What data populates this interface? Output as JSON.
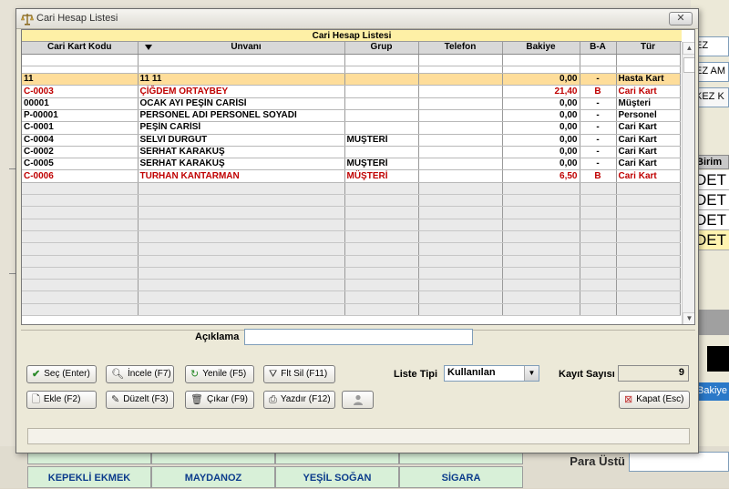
{
  "window": {
    "title": "Cari Hesap Listesi",
    "close_label": "✕"
  },
  "grid": {
    "caption": "Cari Hesap Listesi",
    "columns": [
      "Cari Kart Kodu",
      "Ünvanı",
      "Grup",
      "Telefon",
      "Bakiye",
      "B-A",
      "Tür"
    ],
    "rows": [
      {
        "kod": "11",
        "unvan": "11 11",
        "grup": "",
        "telefon": "",
        "bakiye": "0,00",
        "ba": "-",
        "tur": "Hasta Kart",
        "selected": true,
        "red": false
      },
      {
        "kod": "C-0003",
        "unvan": "ÇİĞDEM ORTAYBEY",
        "grup": "",
        "telefon": "",
        "bakiye": "21,40",
        "ba": "B",
        "tur": "Cari Kart",
        "selected": false,
        "red": true
      },
      {
        "kod": "00001",
        "unvan": "OCAK AYI PEŞİN CARİSİ",
        "grup": "",
        "telefon": "",
        "bakiye": "0,00",
        "ba": "-",
        "tur": "Müşteri",
        "selected": false,
        "red": false
      },
      {
        "kod": "P-00001",
        "unvan": "PERSONEL ADI PERSONEL SOYADI",
        "grup": "",
        "telefon": "",
        "bakiye": "0,00",
        "ba": "-",
        "tur": "Personel",
        "selected": false,
        "red": false
      },
      {
        "kod": "C-0001",
        "unvan": "PEŞİN CARİSİ",
        "grup": "",
        "telefon": "",
        "bakiye": "0,00",
        "ba": "-",
        "tur": "Cari Kart",
        "selected": false,
        "red": false
      },
      {
        "kod": "C-0004",
        "unvan": "SELVİ DURGUT",
        "grup": "MÜŞTERİ",
        "telefon": "",
        "bakiye": "0,00",
        "ba": "-",
        "tur": "Cari Kart",
        "selected": false,
        "red": false
      },
      {
        "kod": "C-0002",
        "unvan": "SERHAT KARAKUŞ",
        "grup": "",
        "telefon": "",
        "bakiye": "0,00",
        "ba": "-",
        "tur": "Cari Kart",
        "selected": false,
        "red": false
      },
      {
        "kod": "C-0005",
        "unvan": "SERHAT KARAKUŞ",
        "grup": "MÜŞTERİ",
        "telefon": "",
        "bakiye": "0,00",
        "ba": "-",
        "tur": "Cari Kart",
        "selected": false,
        "red": false
      },
      {
        "kod": "C-0006",
        "unvan": "TURHAN KANTARMAN",
        "grup": "MÜŞTERİ",
        "telefon": "",
        "bakiye": "6,50",
        "ba": "B",
        "tur": "Cari Kart",
        "selected": false,
        "red": true
      }
    ]
  },
  "aciklama": {
    "label": "Açıklama",
    "value": ""
  },
  "buttons": {
    "sec": "Seç (Enter)",
    "incele": "İncele (F7)",
    "yenile": "Yenile (F5)",
    "flt_sil": "Flt Sil  (F11)",
    "ekle": "Ekle (F2)",
    "duzelt": "Düzelt (F3)",
    "cikar": "Çıkar (F9)",
    "yazdir": "Yazdır  (F12)",
    "kapat": "Kapat (Esc)"
  },
  "liste_tipi": {
    "label": "Liste Tipi",
    "value": "Kullanılan"
  },
  "kayit_sayisi": {
    "label": "Kayıt Sayısı",
    "value": "9"
  },
  "background": {
    "fields": [
      "EZ",
      "EZ AM",
      "KEZ K"
    ],
    "birim_label": "Birim",
    "det_rows": [
      "DET",
      "DET",
      "DET",
      "DET"
    ],
    "bakiye_label": "Bakiye",
    "para_ustu_label": "Para Üstü",
    "products": [
      "KEPEKLİ EKMEK",
      "MAYDANOZ",
      "YEŞİL SOĞAN",
      "SİGARA"
    ]
  },
  "colors": {
    "selected_row": "#fedd9a",
    "red_text": "#c00000",
    "caption_bg": "#fef0a6"
  }
}
